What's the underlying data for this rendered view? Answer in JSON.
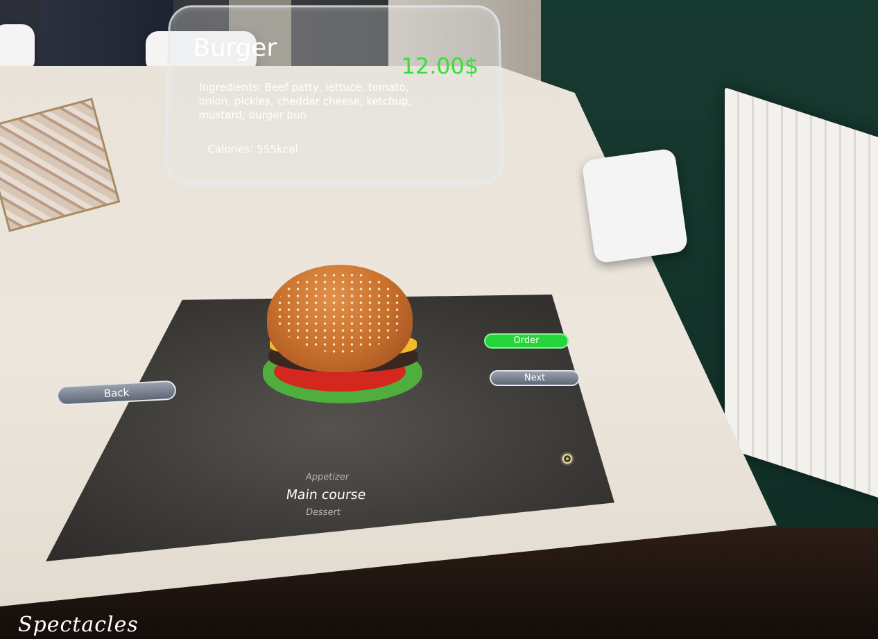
{
  "ar_panel": {
    "title": "Burger",
    "price": "12.00$",
    "ingredients": "Ingredients: Beef patty, lettuce, tomato, onion, pickles, cheddar cheese, ketchup, mustard, burger bun",
    "calories": "Calories: 555kcal"
  },
  "buttons": {
    "back": "Back",
    "order": "Order",
    "next": "Next"
  },
  "categories": {
    "previous": "Appetizer",
    "current": "Main course",
    "next": "Dessert"
  },
  "watermark": "Spectacles",
  "colors": {
    "price": "#34e034",
    "order_button": "#25d63b",
    "text": "#ffffff"
  }
}
